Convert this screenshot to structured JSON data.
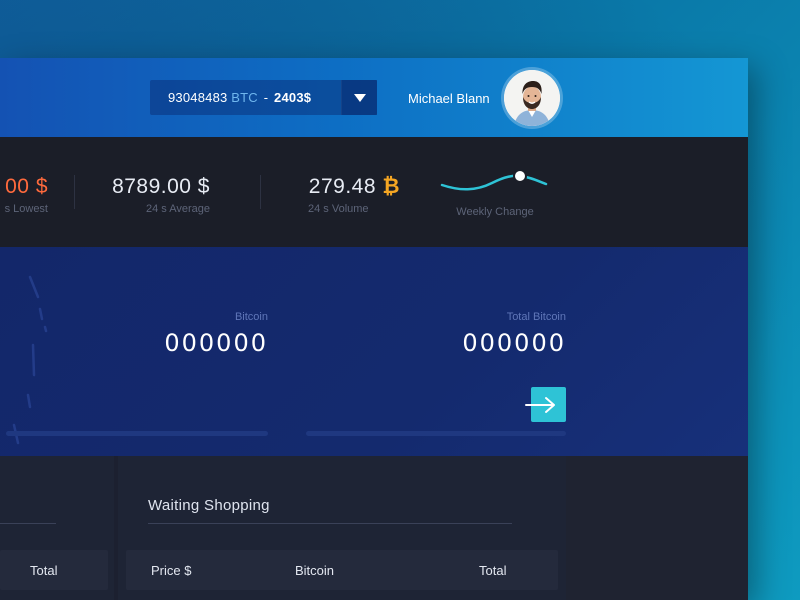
{
  "header": {
    "wallet": {
      "amount": "93048483",
      "unit": "BTC",
      "separator": "-",
      "usd": "2403$"
    },
    "user_name": "Michael Blann"
  },
  "stats": [
    {
      "value": "00 $",
      "label": "s Lowest"
    },
    {
      "value": "8789.00 $",
      "label": "24 s Average"
    },
    {
      "value": "279.48",
      "symbol": "₿",
      "label": "24 s Volume"
    },
    {
      "label": "Weekly Change"
    }
  ],
  "converter": {
    "bitcoin": {
      "label": "Bitcoin",
      "value": "000000"
    },
    "total_bitcoin": {
      "label": "Total Bitcoin",
      "value": "000000"
    }
  },
  "panels": {
    "left": {
      "header_total": "Total"
    },
    "right": {
      "title": "Waiting Shopping",
      "columns": [
        "Price $",
        "Bitcoin",
        "Total"
      ]
    }
  },
  "colors": {
    "accent": "#2ec3d6",
    "orange": "#ff6a3d",
    "btc_gold": "#f5a623",
    "header_start": "#1452b3",
    "header_end": "#1497d4"
  }
}
